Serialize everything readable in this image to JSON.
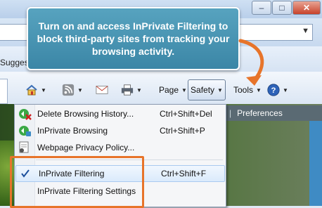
{
  "window": {
    "controls": [
      "minimize",
      "maximize",
      "close"
    ]
  },
  "favorites_bar": {
    "suggested_text": "Suggest"
  },
  "command_bar": {
    "page_label": "Page",
    "safety_label": "Safety",
    "tools_label": "Tools",
    "icons": [
      "home-icon",
      "rss-feed-icon",
      "mail-icon",
      "print-icon",
      "help-icon"
    ]
  },
  "page_tabs": {
    "preferences": "Preferences"
  },
  "safety_menu": {
    "items": [
      {
        "label": "Delete Browsing History...",
        "shortcut": "Ctrl+Shift+Del",
        "icon": "delete-history-icon"
      },
      {
        "label": "InPrivate Browsing",
        "shortcut": "Ctrl+Shift+P",
        "icon": "inprivate-browsing-icon"
      },
      {
        "label": "Webpage Privacy Policy...",
        "shortcut": "",
        "icon": "privacy-policy-icon"
      },
      {
        "label": "InPrivate Filtering",
        "shortcut": "Ctrl+Shift+F",
        "icon": "checkmark-icon",
        "checked": true,
        "highlighted": true
      },
      {
        "label": "InPrivate Filtering Settings",
        "shortcut": "",
        "icon": ""
      }
    ]
  },
  "callout": {
    "text": "Turn on and access InPrivate Filtering to block third-party sites from tracking your browsing activity."
  },
  "colors": {
    "callout_bg": "#4a97b6",
    "highlight_box": "#e7742a",
    "arrow": "#e7742a"
  }
}
